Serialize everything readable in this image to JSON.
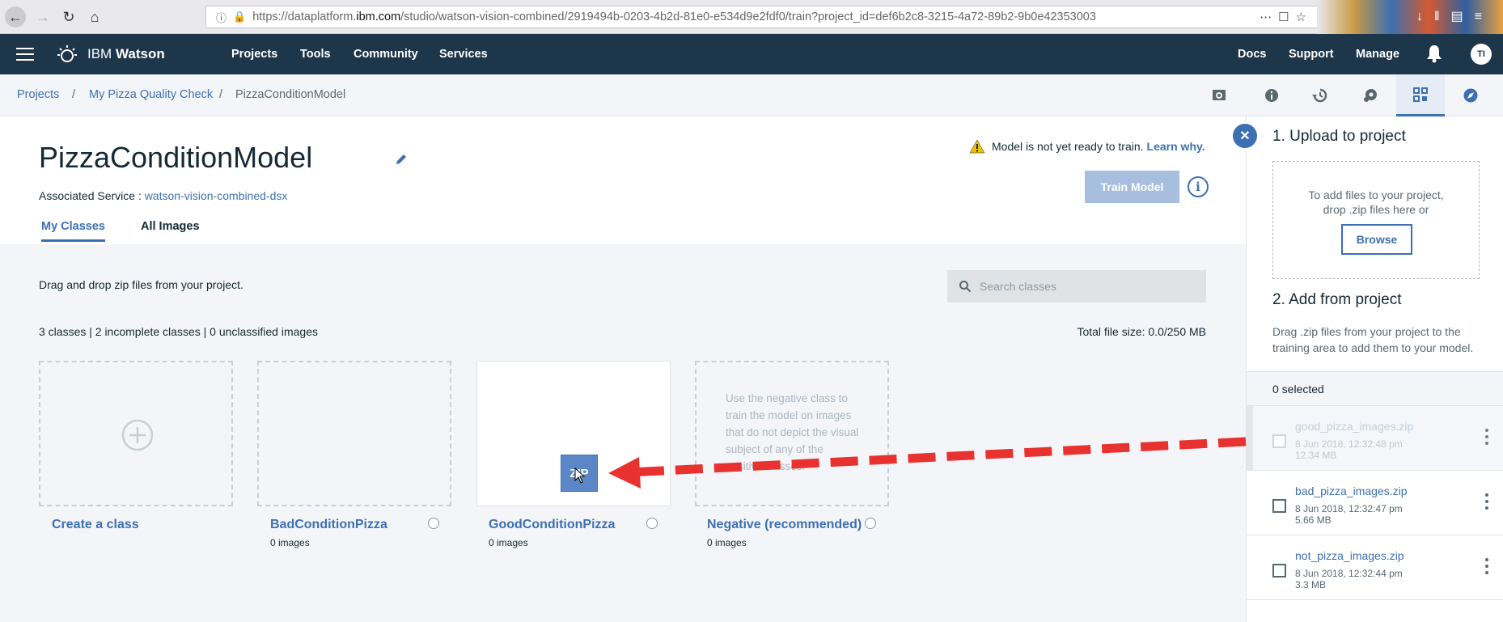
{
  "browser": {
    "url_prefix": "https://dataplatform.",
    "url_domain": "ibm.com",
    "url_rest": "/studio/watson-vision-combined/2919494b-0203-4b2d-81e0-e534d9e2fdf0/train?project_id=def6b2c8-3215-4a72-89b2-9b0e42353003"
  },
  "topnav": {
    "brand_prefix": "IBM",
    "brand_name": "Watson",
    "items": [
      "Projects",
      "Tools",
      "Community",
      "Services"
    ],
    "right_items": [
      "Docs",
      "Support",
      "Manage"
    ],
    "avatar_initials": "TI"
  },
  "breadcrumb": {
    "items": [
      "Projects",
      "My Pizza Quality Check",
      "PizzaConditionModel"
    ],
    "separator": "/"
  },
  "header": {
    "title": "PizzaConditionModel",
    "assoc_label": "Associated Service : ",
    "assoc_service": "watson-vision-combined-dsx",
    "warning_text": "Model is not yet ready to train.",
    "warning_link": "Learn why.",
    "train_button": "Train Model",
    "info_glyph": "i",
    "tabs": [
      "My Classes",
      "All Images"
    ]
  },
  "main": {
    "drag_text": "Drag and drop zip files from your project.",
    "search_placeholder": "Search classes",
    "stats": "3 classes | 2 incomplete classes | 0 unclassified images",
    "total_size": "Total file size: 0.0/250 MB",
    "create_label": "Create a class",
    "classes": [
      {
        "name": "BadConditionPizza",
        "count": "0 images"
      },
      {
        "name": "GoodConditionPizza",
        "count": "0 images"
      },
      {
        "name": "Negative (recommended)",
        "count": "0 images",
        "description": "Use the negative class to train the model on images that do not depict the visual subject of any of the positive classes."
      }
    ],
    "zip_label": "ZIP"
  },
  "right_panel": {
    "close_glyph": "✕",
    "upload_heading": "1. Upload to project",
    "drop_text_1": "To add files to your project,",
    "drop_text_2": "drop .zip files here or",
    "browse_button": "Browse",
    "add_heading": "2. Add from project",
    "add_desc": "Drag .zip files from your project to the training area to add them to your model.",
    "selected_text": "0 selected",
    "files": [
      {
        "name": "good_pizza_images.zip",
        "date": "8 Jun 2018, 12:32:48 pm",
        "size": "12.34 MB"
      },
      {
        "name": "bad_pizza_images.zip",
        "date": "8 Jun 2018, 12:32:47 pm",
        "size": "5.66 MB"
      },
      {
        "name": "not_pizza_images.zip",
        "date": "8 Jun 2018, 12:32:44 pm",
        "size": "3.3 MB"
      }
    ]
  },
  "colors": {
    "accent": "#3d70b2",
    "nav_bg": "#1d3649",
    "arrow": "#e8322f",
    "warning": "#efc100"
  },
  "icons": [
    "hamburger-icon",
    "watson-logo-icon",
    "bell-icon",
    "camera-icon",
    "info-icon",
    "history-icon",
    "palette-icon",
    "data-icon",
    "compass-icon",
    "edit-icon",
    "warning-icon",
    "search-icon",
    "plus-icon",
    "kebab-icon",
    "close-icon"
  ]
}
